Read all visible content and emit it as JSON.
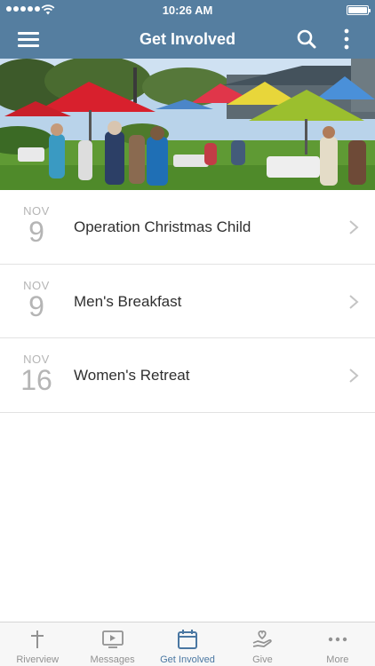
{
  "status_bar": {
    "time": "10:26 AM"
  },
  "nav": {
    "title": "Get Involved",
    "icons": [
      "menu-icon",
      "search-icon",
      "more-vertical-icon"
    ]
  },
  "hero": {
    "alt_icon": "photo-outdoor-gathering"
  },
  "events": [
    {
      "month": "NOV",
      "day": "9",
      "title": "Operation Christmas Child"
    },
    {
      "month": "NOV",
      "day": "9",
      "title": "Men's Breakfast"
    },
    {
      "month": "NOV",
      "day": "16",
      "title": "Women's Retreat"
    }
  ],
  "tabs": [
    {
      "label": "Riverview",
      "icon": "cross-icon",
      "active": false
    },
    {
      "label": "Messages",
      "icon": "play-screen-icon",
      "active": false
    },
    {
      "label": "Get Involved",
      "icon": "calendar-icon",
      "active": true
    },
    {
      "label": "Give",
      "icon": "hand-heart-icon",
      "active": false
    },
    {
      "label": "More",
      "icon": "more-horizontal-icon",
      "active": false
    }
  ],
  "colors": {
    "header": "#557ea0",
    "active_tab": "#4a77a2",
    "inactive_tab": "#929292",
    "date_text": "#b5b5b5"
  }
}
